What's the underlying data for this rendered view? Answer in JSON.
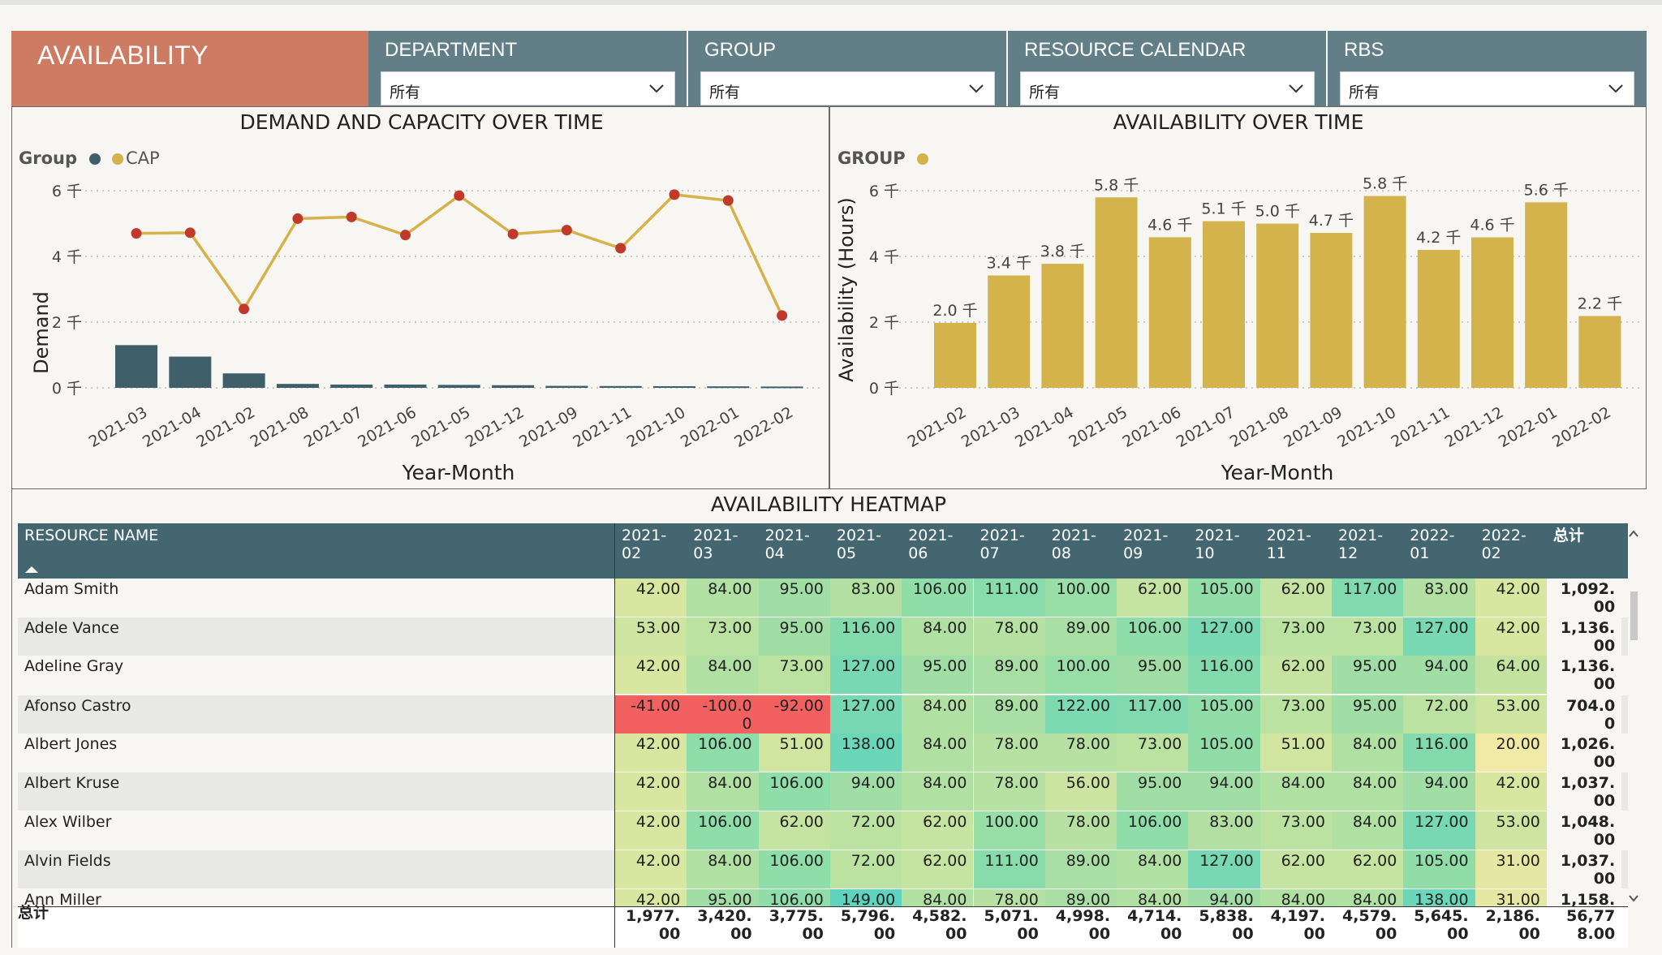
{
  "header": {
    "title": "AVAILABILITY",
    "slicers": [
      {
        "label": "DEPARTMENT",
        "value": "所有"
      },
      {
        "label": "GROUP",
        "value": "所有"
      },
      {
        "label": "RESOURCE CALENDAR",
        "value": "所有"
      },
      {
        "label": "RBS",
        "value": "所有"
      }
    ]
  },
  "colors": {
    "title_bg": "#cd7b62",
    "slicer_bg": "#627f87",
    "table_header_bg": "#446670",
    "bar_dark": "#3f5f6b",
    "line_gold": "#d6b24a",
    "marker_red": "#c0392b",
    "bar_gold": "#d4b24c",
    "negative_red": "#f26060"
  },
  "chart_data": [
    {
      "type": "bar+line",
      "title": "DEMAND AND CAPACITY OVER TIME",
      "legend_title": "Group",
      "legend": [
        "CAP"
      ],
      "xlabel": "Year-Month",
      "ylabel": "Demand",
      "yticks": [
        "0 千",
        "2 千",
        "4 千",
        "6 千"
      ],
      "ylim": [
        0,
        6000
      ],
      "categories": [
        "2021-03",
        "2021-04",
        "2021-02",
        "2021-08",
        "2021-07",
        "2021-06",
        "2021-05",
        "2021-12",
        "2021-09",
        "2021-11",
        "2021-10",
        "2022-01",
        "2022-02"
      ],
      "series": [
        {
          "name": "",
          "kind": "bar",
          "values": [
            1300,
            950,
            440,
            120,
            100,
            100,
            90,
            80,
            60,
            55,
            50,
            45,
            40
          ]
        },
        {
          "name": "CAP",
          "kind": "line",
          "values": [
            4700,
            4720,
            2400,
            5150,
            5200,
            4650,
            5850,
            4680,
            4800,
            4250,
            5880,
            5700,
            2200
          ]
        }
      ]
    },
    {
      "type": "bar",
      "title": "AVAILABILITY OVER TIME",
      "legend_title": "GROUP",
      "xlabel": "Year-Month",
      "ylabel": "Availability (Hours)",
      "yticks": [
        "0 千",
        "2 千",
        "4 千",
        "6 千"
      ],
      "ylim": [
        0,
        6000
      ],
      "categories": [
        "2021-02",
        "2021-03",
        "2021-04",
        "2021-05",
        "2021-06",
        "2021-07",
        "2021-08",
        "2021-09",
        "2021-10",
        "2021-11",
        "2021-12",
        "2022-01",
        "2022-02"
      ],
      "values": [
        1977,
        3420,
        3775,
        5796,
        4582,
        5071,
        4998,
        4714,
        5838,
        4197,
        4579,
        5645,
        2186
      ],
      "data_labels": [
        "2.0 千",
        "3.4 千",
        "3.8 千",
        "5.8 千",
        "4.6 千",
        "5.1 千",
        "5.0 千",
        "4.7 千",
        "5.8 千",
        "4.2 千",
        "4.6 千",
        "5.6 千",
        "2.2 千"
      ]
    },
    {
      "type": "table",
      "title": "AVAILABILITY HEATMAP",
      "columns": [
        "RESOURCE NAME",
        "2021-\n02",
        "2021-\n03",
        "2021-\n04",
        "2021-\n05",
        "2021-\n06",
        "2021-\n07",
        "2021-\n08",
        "2021-\n09",
        "2021-\n10",
        "2021-\n11",
        "2021-\n12",
        "2022-\n01",
        "2022-\n02",
        "总计"
      ],
      "rows": [
        {
          "name": "Adam Smith",
          "values": [
            "42.00",
            "84.00",
            "95.00",
            "83.00",
            "106.00",
            "111.00",
            "100.00",
            "62.00",
            "105.00",
            "62.00",
            "117.00",
            "83.00",
            "42.00"
          ],
          "total": "1,092.\n00"
        },
        {
          "name": "Adele Vance",
          "values": [
            "53.00",
            "73.00",
            "95.00",
            "116.00",
            "84.00",
            "78.00",
            "89.00",
            "106.00",
            "127.00",
            "73.00",
            "73.00",
            "127.00",
            "42.00"
          ],
          "total": "1,136.\n00"
        },
        {
          "name": "Adeline Gray",
          "values": [
            "42.00",
            "84.00",
            "73.00",
            "127.00",
            "95.00",
            "89.00",
            "100.00",
            "95.00",
            "116.00",
            "62.00",
            "95.00",
            "94.00",
            "64.00"
          ],
          "total": "1,136.\n00"
        },
        {
          "name": "Afonso Castro",
          "values": [
            "-41.00",
            "-100.0\n0",
            "-92.00",
            "127.00",
            "84.00",
            "89.00",
            "122.00",
            "117.00",
            "105.00",
            "73.00",
            "95.00",
            "72.00",
            "53.00"
          ],
          "total": "704.0\n0"
        },
        {
          "name": "Albert Jones",
          "values": [
            "42.00",
            "106.00",
            "51.00",
            "138.00",
            "84.00",
            "78.00",
            "78.00",
            "73.00",
            "105.00",
            "51.00",
            "84.00",
            "116.00",
            "20.00"
          ],
          "total": "1,026.\n00"
        },
        {
          "name": "Albert Kruse",
          "values": [
            "42.00",
            "84.00",
            "106.00",
            "94.00",
            "84.00",
            "78.00",
            "56.00",
            "95.00",
            "94.00",
            "84.00",
            "84.00",
            "94.00",
            "42.00"
          ],
          "total": "1,037.\n00"
        },
        {
          "name": "Alex Wilber",
          "values": [
            "42.00",
            "106.00",
            "62.00",
            "72.00",
            "62.00",
            "100.00",
            "78.00",
            "106.00",
            "83.00",
            "73.00",
            "84.00",
            "127.00",
            "53.00"
          ],
          "total": "1,048.\n00"
        },
        {
          "name": "Alvin Fields",
          "values": [
            "42.00",
            "84.00",
            "106.00",
            "72.00",
            "62.00",
            "111.00",
            "89.00",
            "84.00",
            "127.00",
            "62.00",
            "62.00",
            "105.00",
            "31.00"
          ],
          "total": "1,037.\n00"
        },
        {
          "name": "Ann Miller",
          "values": [
            "42.00",
            "95.00",
            "106.00",
            "149.00",
            "84.00",
            "78.00",
            "89.00",
            "84.00",
            "94.00",
            "84.00",
            "84.00",
            "138.00",
            "31.00"
          ],
          "total": "1,158."
        }
      ],
      "totals_label": "总计",
      "totals": [
        "1,977.\n00",
        "3,420.\n00",
        "3,775.\n00",
        "5,796.\n00",
        "4,582.\n00",
        "5,071.\n00",
        "4,998.\n00",
        "4,714.\n00",
        "5,838.\n00",
        "4,197.\n00",
        "4,579.\n00",
        "5,645.\n00",
        "2,186.\n00",
        "56,77\n8.00"
      ]
    }
  ]
}
